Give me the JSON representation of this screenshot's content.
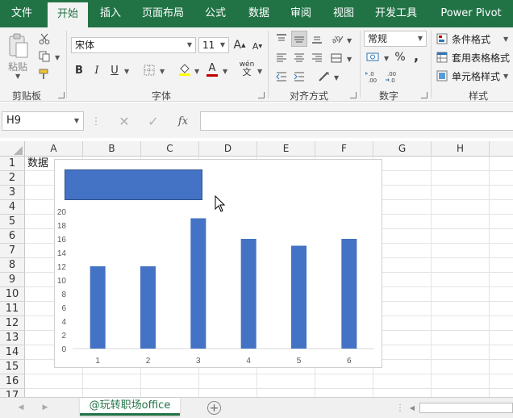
{
  "tabs": [
    {
      "label": "文件",
      "active": false
    },
    {
      "label": "开始",
      "active": true
    },
    {
      "label": "插入",
      "active": false
    },
    {
      "label": "页面布局",
      "active": false
    },
    {
      "label": "公式",
      "active": false
    },
    {
      "label": "数据",
      "active": false
    },
    {
      "label": "审阅",
      "active": false
    },
    {
      "label": "视图",
      "active": false
    },
    {
      "label": "开发工具",
      "active": false
    },
    {
      "label": "Power Pivot",
      "active": false
    }
  ],
  "ribbon": {
    "clipboard": {
      "label": "剪贴板",
      "paste_label": "粘贴"
    },
    "font": {
      "label": "字体",
      "name": "宋体",
      "size": "11",
      "bold": "B",
      "italic": "I",
      "underline": "U",
      "inc": "A",
      "dec": "A",
      "color_glyph": "A",
      "phonetic": "wén",
      "phonetic_char": "文"
    },
    "alignment": {
      "label": "对齐方式"
    },
    "number": {
      "label": "数字",
      "format": "常规",
      "percent": "%",
      "comma": ",",
      "inc_decimal": "←.0\n.00",
      "dec_decimal": ".00\n→.0"
    },
    "styles": {
      "label": "样式",
      "cond_format": "条件格式",
      "table_format": "套用表格格式",
      "cell_styles": "单元格样式"
    }
  },
  "formula_bar": {
    "name_box": "H9",
    "fx": "fx",
    "value": ""
  },
  "columns": [
    "A",
    "B",
    "C",
    "D",
    "E",
    "F",
    "G",
    "H"
  ],
  "rows": [
    "1",
    "2",
    "3",
    "4",
    "5",
    "6",
    "7",
    "8",
    "9",
    "10",
    "11",
    "12",
    "13",
    "14",
    "15",
    "16",
    "17"
  ],
  "cells": {
    "A1": "数据"
  },
  "chart_data": {
    "type": "bar",
    "categories": [
      "1",
      "2",
      "3",
      "4",
      "5",
      "6"
    ],
    "values": [
      12,
      12,
      19,
      16,
      15,
      16
    ],
    "ylim": [
      0,
      20
    ],
    "yticks": [
      "0",
      "2",
      "4",
      "6",
      "8",
      "10",
      "12",
      "14",
      "16",
      "18",
      "20"
    ],
    "title": "",
    "xlabel": "",
    "ylabel": "",
    "color": "#4472c4"
  },
  "sheet_tabs": [
    {
      "label": "@玩转职场office",
      "active": true
    }
  ],
  "colors": {
    "accent": "#217346",
    "bar": "#4472c4"
  }
}
